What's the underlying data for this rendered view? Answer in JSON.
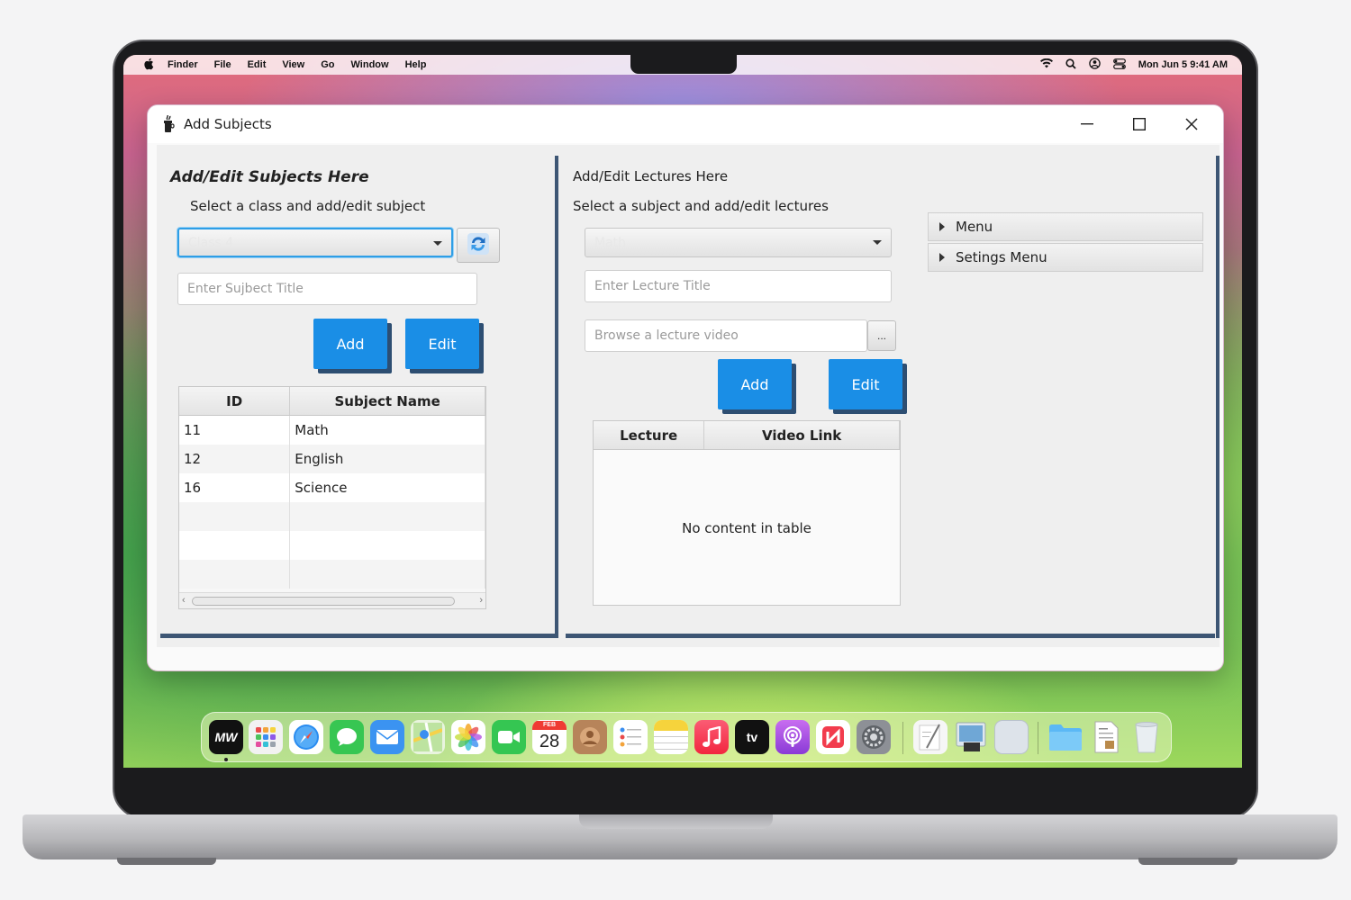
{
  "menubar": {
    "apple": "",
    "items": [
      "Finder",
      "File",
      "Edit",
      "View",
      "Go",
      "Window",
      "Help"
    ],
    "clock": "Mon Jun 5  9:41 AM"
  },
  "window": {
    "title": "Add Subjects"
  },
  "left": {
    "heading": "Add/Edit Subjects Here",
    "subheading": "Select a class and add/edit subject",
    "class_select": "Class 4",
    "subject_placeholder": "Enter Sujbect Title",
    "add_label": "Add",
    "edit_label": "Edit",
    "table": {
      "columns": [
        "ID",
        "Subject Name"
      ],
      "rows": [
        [
          "11",
          "Math"
        ],
        [
          "12",
          "English"
        ],
        [
          "16",
          "Science"
        ],
        [
          "",
          ""
        ],
        [
          "",
          ""
        ],
        [
          "",
          ""
        ]
      ]
    }
  },
  "right": {
    "heading": "Add/Edit Lectures Here",
    "subheading": "Select a subject and add/edit lectures",
    "subject_select": "Math",
    "lecture_placeholder": "Enter Lecture Title",
    "video_placeholder": "Browse a lecture video",
    "browse_label": "...",
    "add_label": "Add",
    "edit_label": "Edit",
    "table": {
      "columns": [
        "Lecture",
        "Video Link"
      ],
      "empty_message": "No content in table"
    },
    "accordion": [
      "Menu",
      "Setings Menu"
    ]
  },
  "dock": {
    "calendar_month": "FEB",
    "calendar_day": "28",
    "tv_label": "tv",
    "icons": [
      "mw-app-icon",
      "launchpad-icon",
      "safari-icon",
      "messages-icon",
      "mail-icon",
      "maps-icon",
      "photos-icon",
      "facetime-icon",
      "calendar-icon",
      "contacts-icon",
      "reminders-icon",
      "notes-icon",
      "music-icon",
      "appletv-icon",
      "podcasts-icon",
      "news-icon",
      "system-settings-icon",
      "textedit-icon",
      "preview-icon",
      "blank-app-icon",
      "folder-icon",
      "document-icon",
      "trash-icon"
    ]
  },
  "colors": {
    "accent_blue": "#1a8ee6",
    "panel_border": "#3d5674",
    "focus_ring": "#2e9ee6"
  }
}
